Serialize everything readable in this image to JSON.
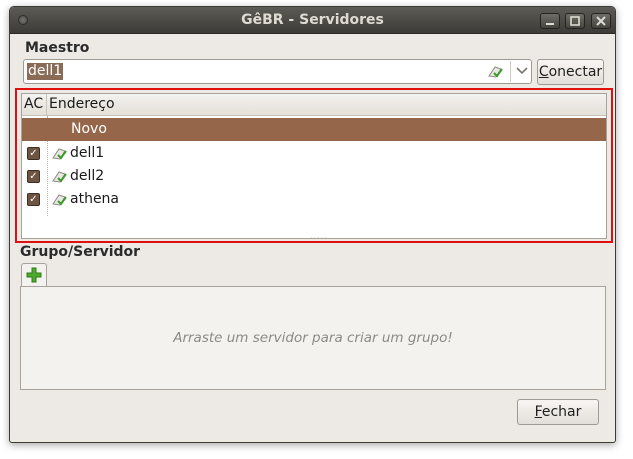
{
  "window": {
    "title": "GêBR - Servidores",
    "controls": [
      "minimize",
      "maximize",
      "close"
    ]
  },
  "maestro": {
    "label": "Maestro",
    "selected_value": "dell1",
    "connect_button": {
      "mnemonic": "C",
      "rest": "onectar"
    }
  },
  "server_list": {
    "columns": [
      "AC",
      "Endereço"
    ],
    "new_row_label": "Novo",
    "rows": [
      {
        "checked": true,
        "name": "dell1",
        "icon": "server-connected-icon"
      },
      {
        "checked": true,
        "name": "dell2",
        "icon": "server-connected-icon"
      },
      {
        "checked": true,
        "name": "athena",
        "icon": "server-connected-icon"
      }
    ]
  },
  "group": {
    "label": "Grupo/Servidor",
    "add_tab_icon": "add-icon",
    "empty_hint": "Arraste um servidor para criar um grupo!"
  },
  "close_button": {
    "mnemonic": "F",
    "rest": "echar"
  },
  "colors": {
    "selection": "#95664a",
    "highlight_frame": "#e01010",
    "checkbox": "#6e5543",
    "titlebar": "#3c3b37"
  }
}
